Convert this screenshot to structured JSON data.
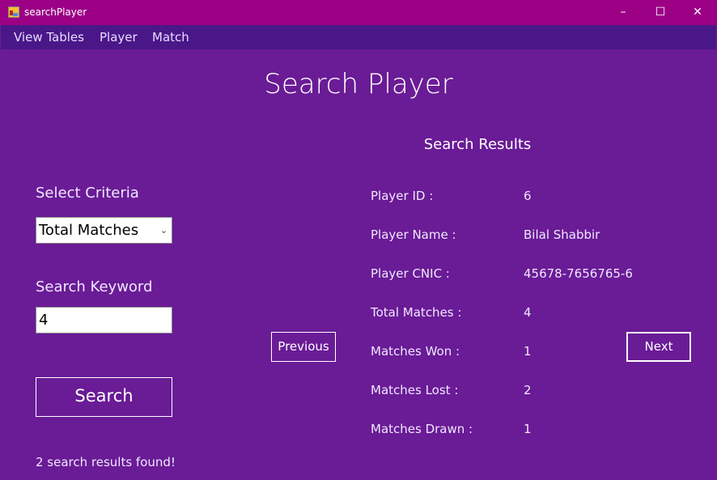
{
  "window": {
    "title": "searchPlayer",
    "minimize": "–",
    "maximize": "☐",
    "close": "✕"
  },
  "menu": [
    "View Tables",
    "Player",
    "Match"
  ],
  "page_title": "Search Player",
  "results_title": "Search Results",
  "criteria": {
    "label": "Select Criteria",
    "selected": "Total Matches"
  },
  "keyword": {
    "label": "Search Keyword",
    "value": "4"
  },
  "search_button": "Search",
  "previous_button": "Previous",
  "next_button": "Next",
  "status": "2 search results found!",
  "results": [
    {
      "label": "Player ID :",
      "value": "6"
    },
    {
      "label": "Player Name :",
      "value": "Bilal Shabbir"
    },
    {
      "label": "Player CNIC :",
      "value": "45678-7656765-6"
    },
    {
      "label": "Total Matches :",
      "value": "4"
    },
    {
      "label": "Matches Won :",
      "value": "1"
    },
    {
      "label": "Matches Lost :",
      "value": "2"
    },
    {
      "label": "Matches Drawn :",
      "value": "1"
    }
  ]
}
